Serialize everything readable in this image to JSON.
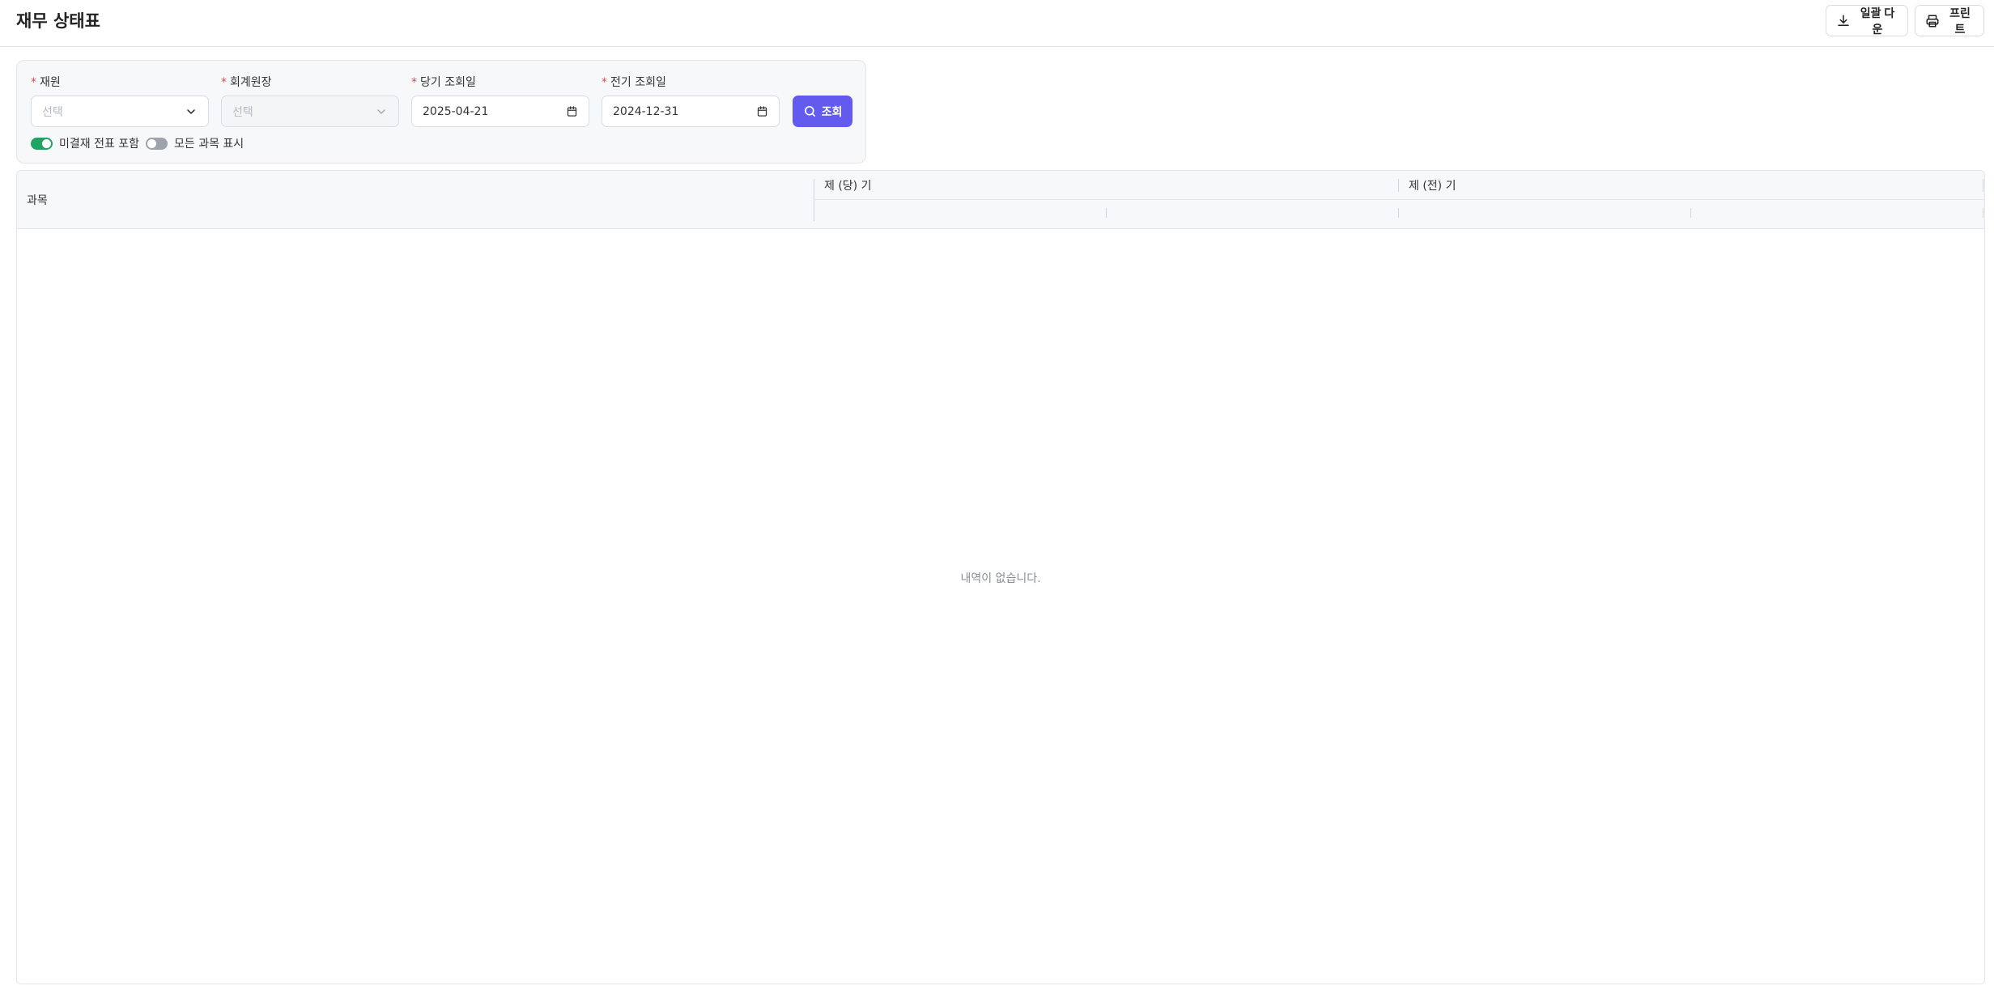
{
  "header": {
    "title": "재무 상태표",
    "excel_label": "일괄 다운",
    "print_label": "프린트"
  },
  "filters": {
    "fund": {
      "label": "재원",
      "placeholder": "선택"
    },
    "ledger": {
      "label": "회계원장",
      "placeholder": "선택"
    },
    "current_date": {
      "label": "당기 조회일",
      "value": "2025-04-21"
    },
    "previous_date": {
      "label": "전기 조회일",
      "value": "2024-12-31"
    },
    "search_label": "조회",
    "include_unapproved": {
      "label": "미결재 전표 포함",
      "on": true
    },
    "show_all_accounts": {
      "label": "모든 과목 표시",
      "on": false
    }
  },
  "table": {
    "col_subject": "과목",
    "col_current": "제 (당) 기",
    "col_previous": "제 (전) 기",
    "empty_message": "내역이 없습니다."
  },
  "colors": {
    "accent": "#635bf0",
    "toggle_on": "#1fa463",
    "toggle_off": "#9ea3ab",
    "required": "#e5484d"
  }
}
